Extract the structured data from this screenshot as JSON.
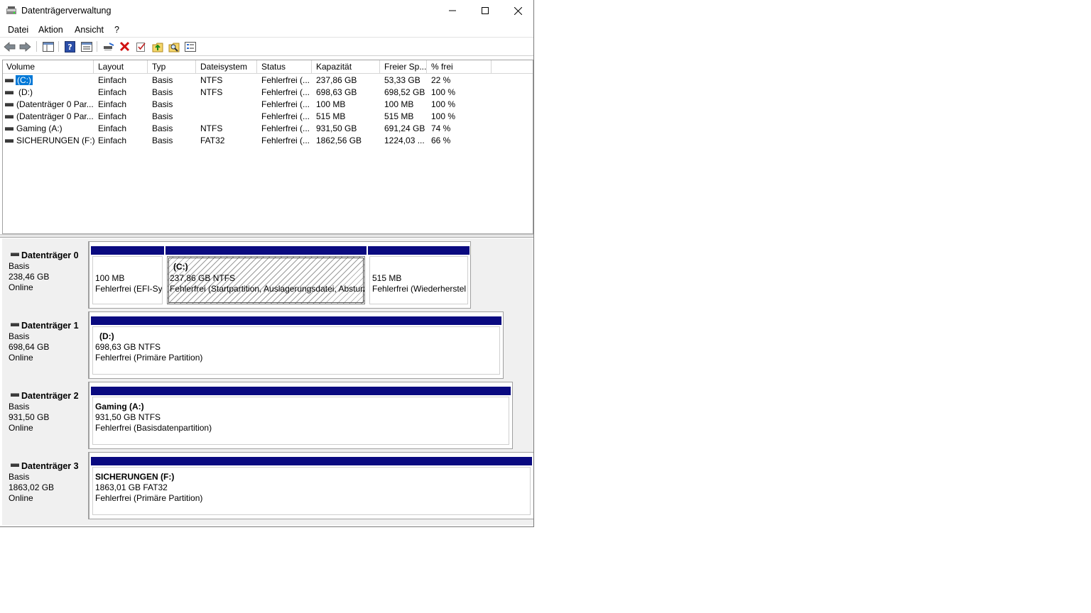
{
  "window": {
    "title": "Datenträgerverwaltung"
  },
  "menu": [
    "Datei",
    "Aktion",
    "Ansicht",
    "?"
  ],
  "toolbar": [
    "back-icon",
    "forward-icon",
    "console-tree-icon",
    "help-icon",
    "properties-view-icon",
    "connect-icon",
    "delete-icon",
    "check-icon",
    "folder-up-icon",
    "search-icon",
    "list-icon"
  ],
  "columns": [
    "Volume",
    "Layout",
    "Typ",
    "Dateisystem",
    "Status",
    "Kapazität",
    "Freier Sp...",
    "% frei"
  ],
  "volumes": [
    {
      "volume": "(C:)",
      "layout": "Einfach",
      "typ": "Basis",
      "fs": "NTFS",
      "status": "Fehlerfrei (...",
      "kap": "237,86 GB",
      "frei": "53,33 GB",
      "pct": "22 %"
    },
    {
      "volume": "(D:)",
      "layout": "Einfach",
      "typ": "Basis",
      "fs": "NTFS",
      "status": "Fehlerfrei (...",
      "kap": "698,63 GB",
      "frei": "698,52 GB",
      "pct": "100 %"
    },
    {
      "volume": "(Datenträger 0 Par...",
      "layout": "Einfach",
      "typ": "Basis",
      "fs": "",
      "status": "Fehlerfrei (...",
      "kap": "100 MB",
      "frei": "100 MB",
      "pct": "100 %"
    },
    {
      "volume": "(Datenträger 0 Par...",
      "layout": "Einfach",
      "typ": "Basis",
      "fs": "",
      "status": "Fehlerfrei (...",
      "kap": "515 MB",
      "frei": "515 MB",
      "pct": "100 %"
    },
    {
      "volume": "Gaming (A:)",
      "layout": "Einfach",
      "typ": "Basis",
      "fs": "NTFS",
      "status": "Fehlerfrei (...",
      "kap": "931,50 GB",
      "frei": "691,24 GB",
      "pct": "74 %"
    },
    {
      "volume": "SICHERUNGEN (F:)",
      "layout": "Einfach",
      "typ": "Basis",
      "fs": "FAT32",
      "status": "Fehlerfrei (...",
      "kap": "1862,56 GB",
      "frei": "1224,03 ...",
      "pct": "66 %"
    }
  ],
  "disks": [
    {
      "name": "Datenträger 0",
      "type": "Basis",
      "size": "238,46 GB",
      "state": "Online",
      "partitions": [
        {
          "title": "",
          "l1": "100 MB",
          "l2": "Fehlerfrei (EFI-Sy"
        },
        {
          "title": "(C:)",
          "l1": "237,86 GB NTFS",
          "l2": "Fehlerfrei (Startpartition, Auslagerungsdatei, Absturz"
        },
        {
          "title": "",
          "l1": "515 MB",
          "l2": "Fehlerfrei (Wiederherstel"
        }
      ]
    },
    {
      "name": "Datenträger 1",
      "type": "Basis",
      "size": "698,64 GB",
      "state": "Online",
      "partitions": [
        {
          "title": "(D:)",
          "l1": "698,63 GB NTFS",
          "l2": "Fehlerfrei (Primäre Partition)"
        }
      ]
    },
    {
      "name": "Datenträger 2",
      "type": "Basis",
      "size": "931,50 GB",
      "state": "Online",
      "partitions": [
        {
          "title": "Gaming  (A:)",
          "l1": "931,50 GB NTFS",
          "l2": "Fehlerfrei (Basisdatenpartition)"
        }
      ]
    },
    {
      "name": "Datenträger 3",
      "type": "Basis",
      "size": "1863,02 GB",
      "state": "Online",
      "partitions": [
        {
          "title": "SICHERUNGEN  (F:)",
          "l1": "1863,01 GB FAT32",
          "l2": "Fehlerfrei (Primäre Partition)"
        }
      ]
    }
  ],
  "colors": {
    "partition_bar": "#0a0a80",
    "selection": "#0078d7"
  }
}
